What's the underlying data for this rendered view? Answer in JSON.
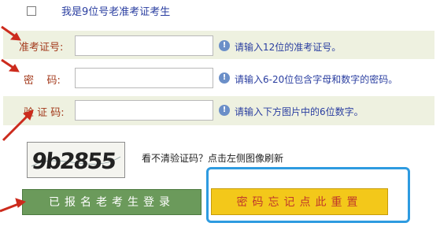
{
  "checkbox": {
    "label": "我是9位号老准考证考生"
  },
  "fields": [
    {
      "label": "准考证号:",
      "hint": "请输入12位的准考证号。"
    },
    {
      "label": "密    码:",
      "hint": "请输入6-20位包含字母和数字的密码。"
    },
    {
      "label": "验 证 码:",
      "hint": "请输入下方图片中的6位数字。"
    }
  ],
  "captcha": {
    "image_text": "9b2855",
    "hint": "看不清验证码？点击左侧图像刷新"
  },
  "buttons": {
    "login": "已报名老考生登录",
    "reset": "密码忘记点此重置"
  },
  "colors": {
    "accent_red": "#cc2b1d",
    "frame_blue": "#2e9be0",
    "login_green": "#6b9a5b",
    "reset_yellow": "#f3c81a"
  }
}
